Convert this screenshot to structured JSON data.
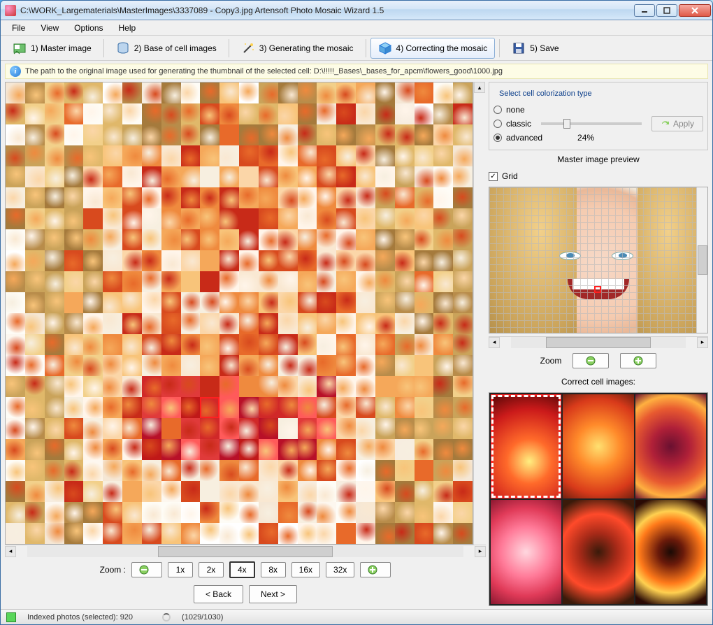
{
  "window": {
    "title": "C:\\WORK_Largematerials\\MasterImages\\3337089 - Copy3.jpg Artensoft Photo Mosaic Wizard 1.5"
  },
  "menu": [
    "File",
    "View",
    "Options",
    "Help"
  ],
  "toolbar": {
    "master": "1) Master image",
    "base": "2) Base of cell images",
    "gen": "3) Generating the mosaic",
    "correct": "4) Correcting the mosaic",
    "save": "5) Save"
  },
  "infobar": {
    "text": "The path to the original image used for generating the thumbnail of the selected cell: D:\\!!!!!_Bases\\_bases_for_apcm\\flowers_good\\1000.jpg"
  },
  "zoom": {
    "label": "Zoom  :",
    "levels": [
      "1x",
      "2x",
      "4x",
      "8x",
      "16x",
      "32x"
    ],
    "active": "4x"
  },
  "nav": {
    "back": "< Back",
    "next": "Next >"
  },
  "colorization": {
    "title": "Select cell colorization type",
    "none": "none",
    "classic": "classic",
    "advanced": "advanced",
    "value": "24%",
    "apply": "Apply"
  },
  "preview": {
    "title": "Master image preview",
    "grid": "Grid",
    "zoom": "Zoom"
  },
  "correct": {
    "title": "Correct cell images:"
  },
  "status": {
    "indexed": "Indexed photos (selected): 920",
    "progress": "(1029/1030)"
  }
}
